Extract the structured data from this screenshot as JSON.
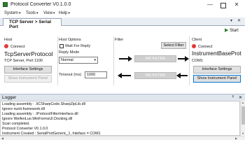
{
  "window": {
    "title": "Protocol Converter V0.1.0.0",
    "minimize": "—",
    "close": "✕"
  },
  "menu": [
    {
      "label": "System"
    },
    {
      "label": "Tools"
    },
    {
      "label": "View"
    },
    {
      "label": "Help"
    }
  ],
  "tab": {
    "label": "TCP Server > Serial Port",
    "menu_icon": "▾",
    "close_icon": "✕"
  },
  "toolbar": {
    "start_label": "Start",
    "start_icon": "▶"
  },
  "host": {
    "group_label": "Host",
    "status_label": "Connect",
    "name": "TcpServerProtocol",
    "detail": "TCP Server, Port 1100",
    "settings_button": "Interface Settings",
    "panel_button": "Show Instrument Panel"
  },
  "host_options": {
    "group_label": "Host Options",
    "wait_for_reply_label": "Wait For Reply",
    "wait_for_reply_checked": false,
    "reply_mode_label": "Reply Mode",
    "reply_mode_value": "Normal",
    "timeout_label": "Timeout (ms)",
    "timeout_value": "1000"
  },
  "filter": {
    "group_label": "Filter",
    "select_button": "Select Filter",
    "top_filter_label": "NO FILTER",
    "bottom_filter_label": "NO FILTER"
  },
  "client": {
    "group_label": "Client",
    "status_label": "Connect",
    "name": "InstrumentBaseProt",
    "detail": "COM1",
    "settings_button": "Interface Settings",
    "panel_button": "Show Instrument Panel"
  },
  "logger": {
    "title": "Logger",
    "pin_icon": "ᵖ",
    "close_icon": "✕",
    "lines": [
      "Loading assembly : .\\ICSharpCode.SharpZipLib.dll",
      "Ignore nunit.framework.dll",
      "Loading assembly : .\\ProtocolFilterInterface.dll",
      "Ignore WeifenLuo.WinFormsUI.Docking.dll",
      "Scan completed.",
      "Protocol Converter V0.1.0.0",
      "Instrument Created : SerialPortGeneric_1, Inteface = COM1"
    ]
  },
  "colors": {
    "status_disconnected": "#e53935",
    "start_play": "#2e7d32",
    "app_icon": "#2e7d32"
  }
}
